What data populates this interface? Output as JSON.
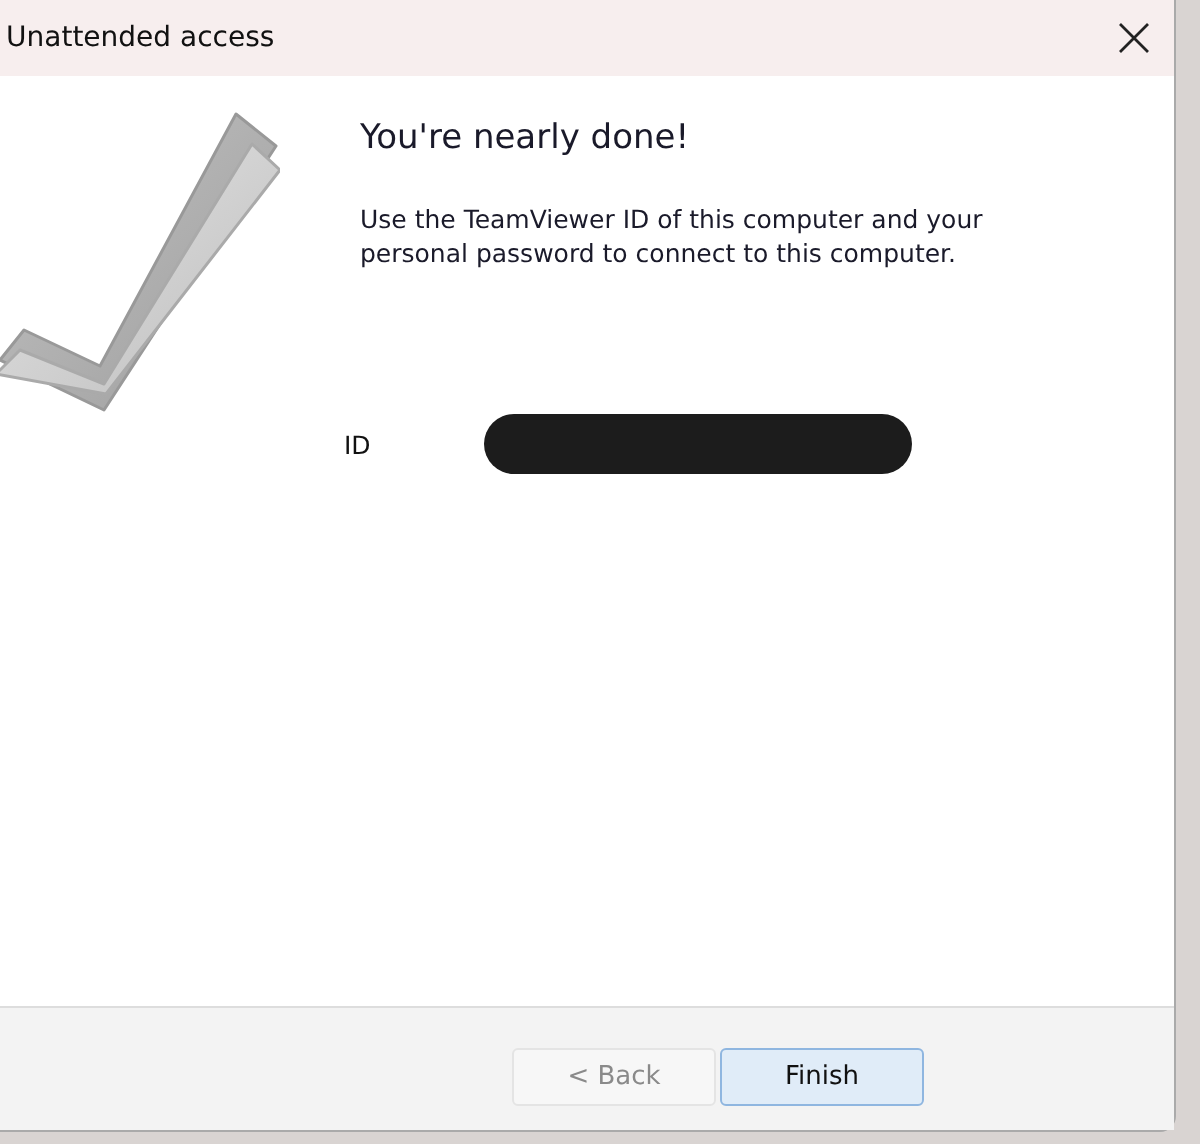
{
  "window": {
    "title": "Unattended access"
  },
  "heading": "You're nearly done!",
  "description": "Use the TeamViewer ID of this computer and your personal password to connect to this computer.",
  "id_field": {
    "label": "ID",
    "redacted": true
  },
  "buttons": [
    {
      "label": "< Back",
      "disabled": true,
      "default": false
    },
    {
      "label": "Finish",
      "disabled": false,
      "default": true
    }
  ]
}
